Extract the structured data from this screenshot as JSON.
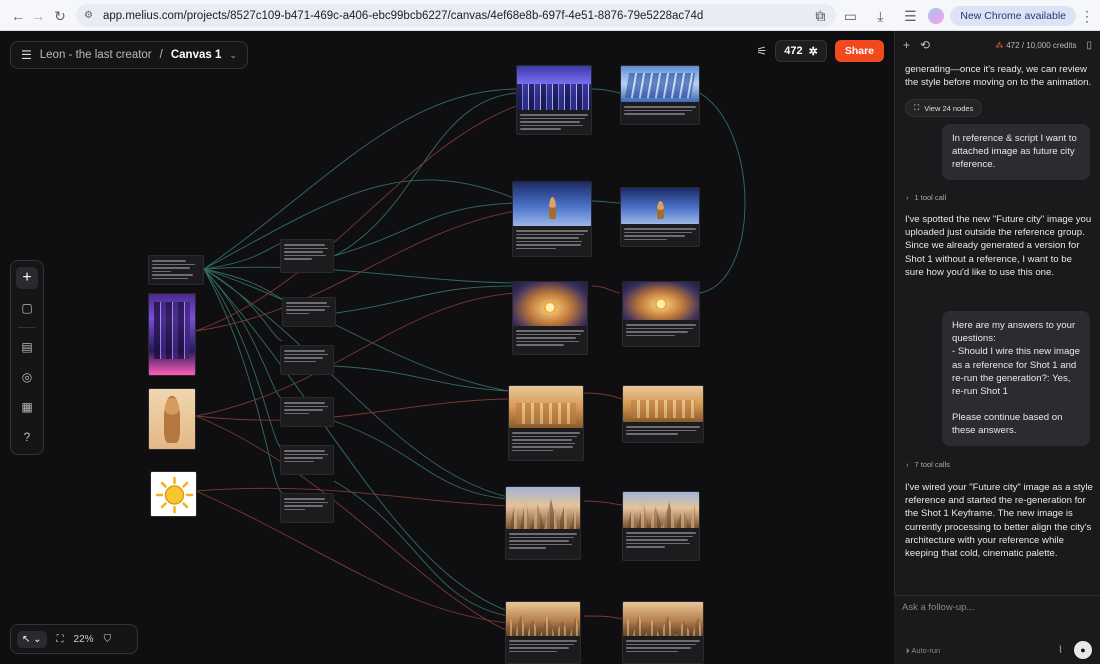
{
  "browser": {
    "url": "app.melius.com/projects/8527c109-b471-469c-a406-ebc99bcb6227/canvas/4ef68e8b-697f-4e51-8876-79e5228ac74d",
    "update_label": "New Chrome available",
    "icons": [
      "back-arrow-icon",
      "forward-arrow-icon",
      "reload-icon",
      "site-info-icon",
      "star-icon",
      "extensions-icon",
      "cast-icon",
      "download-icon",
      "tab-search-icon",
      "profile-avatar",
      "more-menu-icon"
    ]
  },
  "toolbar": {
    "breadcrumb_project": "Leon - the last creator",
    "breadcrumb_sep": "/",
    "canvas_name": "Canvas 1",
    "credits": "472",
    "share_label": "Share"
  },
  "bottombar": {
    "zoom": "22%"
  },
  "panel": {
    "credits_label": "472 / 10,000 credits",
    "messages": {
      "ai1_tail": "generating—once it's ready, we can review the style before moving on to the animation.",
      "view_nodes": "View 24 nodes",
      "user1": "In reference & script I want to attached image as future city reference.",
      "toolcall1": "1 tool call",
      "ai2": "I've spotted the new \"Future city\" image you uploaded just outside the reference group. Since we already generated a version for Shot 1 without a reference, I want to be sure how you'd like to use this one.",
      "user2_l1": "Here are my answers to your questions:",
      "user2_l2": "- Should I wire this new image as a reference for Shot 1 and re-run the generation?: Yes, re-run Shot 1",
      "user2_l3": "Please continue based on these answers.",
      "toolcall2": "7 tool calls",
      "ai3": "I've wired your \"Future city\" image as a style reference and started the re-generation for the Shot 1 Keyframe. The new image is currently processing to better align the city's architecture with your reference while keeping that cold, cinematic palette."
    },
    "composer_placeholder": "Ask a follow-up...",
    "auto_run_label": "Auto-run"
  }
}
